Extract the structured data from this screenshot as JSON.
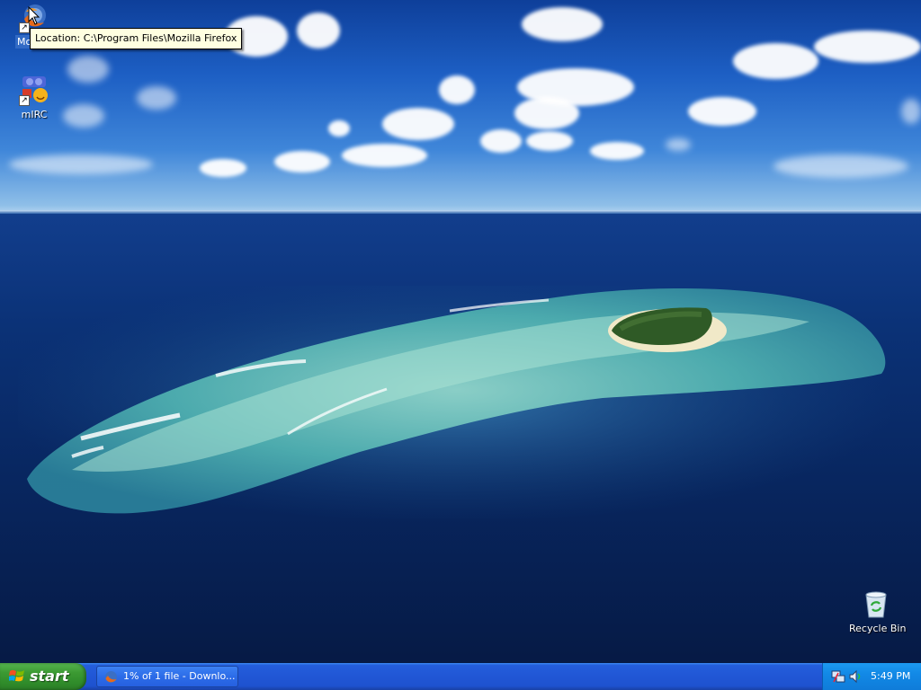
{
  "desktop": {
    "icons": [
      {
        "label": "Mozilla Firefox",
        "short_label": "Mozilla",
        "icon": "firefox-icon",
        "selected": true
      },
      {
        "label": "mIRC",
        "icon": "mirc-icon",
        "selected": false
      },
      {
        "label": "Recycle Bin",
        "icon": "recycle-bin-icon",
        "selected": false
      }
    ],
    "tooltip": "Location: C:\\Program Files\\Mozilla Firefox"
  },
  "taskbar": {
    "start_label": "start",
    "tasks": [
      {
        "label": "1% of 1 file - Downlo...",
        "icon": "firefox-icon"
      }
    ],
    "tray": {
      "icons": [
        "network-icon",
        "volume-icon"
      ],
      "clock": "5:49 PM"
    }
  },
  "colors": {
    "taskbar_blue": "#245edb",
    "start_green": "#3c9a33",
    "tray_blue": "#0f7cd9",
    "selection_blue": "#316ac5",
    "tooltip_bg": "#ffffe1"
  }
}
